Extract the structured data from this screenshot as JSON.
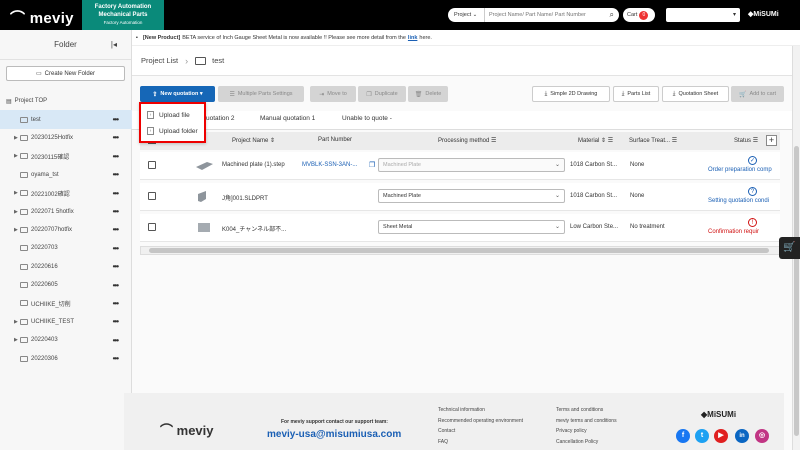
{
  "header": {
    "logo": "meviy",
    "fa_line1": "Factory Automation",
    "fa_line2": "Mechanical Parts",
    "fa_line3": "Factory Automation",
    "search_select": "Project",
    "search_placeholder": "Project Name/ Part Name/ Part Number",
    "cart_label": "Cart",
    "cart_count": "0",
    "brand": "MiSUMi"
  },
  "sidebar": {
    "title": "Folder",
    "create_label": "Create New Folder",
    "root": "Project TOP",
    "items": [
      {
        "label": "test",
        "arrow": "",
        "selected": true
      },
      {
        "label": "20230125Hotfix",
        "arrow": "▶"
      },
      {
        "label": "20230115確認",
        "arrow": "▶"
      },
      {
        "label": "oyama_tst",
        "arrow": ""
      },
      {
        "label": "20221002確認",
        "arrow": "▶"
      },
      {
        "label": "2022071 5hotfix",
        "arrow": "▶"
      },
      {
        "label": "20220707hotfix",
        "arrow": "▶"
      },
      {
        "label": "20220703",
        "arrow": ""
      },
      {
        "label": "20220616",
        "arrow": ""
      },
      {
        "label": "20220605",
        "arrow": ""
      },
      {
        "label": "UCHIIKE_切削",
        "arrow": ""
      },
      {
        "label": "UCHIIKE_TEST",
        "arrow": "▶"
      },
      {
        "label": "20220403",
        "arrow": "▶"
      },
      {
        "label": "20220306",
        "arrow": ""
      }
    ]
  },
  "banner": {
    "tag": "[New Product]",
    "text": "BETA service of Inch Gauge Sheet Metal is now available !! Please see more detail from the",
    "link": "link",
    "tail": "here."
  },
  "breadcrumb": {
    "root": "Project List",
    "current": "test"
  },
  "toolbar": {
    "new_quotation": "New quotation",
    "multiple_parts": "Multiple Parts Settings",
    "move_to": "Move to",
    "duplicate": "Duplicate",
    "delete": "Delete",
    "simple_2d": "Simple 2D Drawing",
    "parts_list": "Parts List",
    "quotation_sheet": "Quotation Sheet",
    "add_to_cart": "Add to cart"
  },
  "popup": {
    "upload_file": "Upload file",
    "upload_folder": "Upload folder"
  },
  "tabs": [
    "uotation 2",
    "Manual quotation 1",
    "Unable to quote -"
  ],
  "table": {
    "headers": {
      "project_name": "Project Name",
      "part_number": "Part Number",
      "processing": "Processing method",
      "material": "Material",
      "surface": "Surface Treat...",
      "status": "Status"
    },
    "rows": [
      {
        "name": "Machined plate (1).step",
        "part": "MVBLK-SSN-3AN-...",
        "process": "Machined Plate",
        "material": "1018 Carbon St...",
        "surface": "None",
        "status": "Order preparation comp",
        "status_color": "#1a5fb4",
        "status_icon": "✓"
      },
      {
        "name": "J角]001.SLDPRT",
        "part": "",
        "process": "Machined Plate",
        "material": "1018 Carbon St...",
        "surface": "None",
        "status": "Setting quotation condi",
        "status_color": "#1a5fb4",
        "status_icon": "?"
      },
      {
        "name": "K004_チャンネル部不...",
        "part": "",
        "process": "Sheet Metal",
        "material": "Low Carbon Ste...",
        "surface": "No treatment",
        "status": "Confirmation requir",
        "status_color": "#d01010",
        "status_icon": "!"
      }
    ]
  },
  "footer": {
    "logo": "meviy",
    "support": "For meviy support contact our support team:",
    "email": "meviy-usa@misumiusa.com",
    "col1": [
      "Technical information",
      "Recommended operating environment",
      "Contact",
      "FAQ"
    ],
    "col2": [
      "Terms and conditions",
      "meviy terms and conditions",
      "Privacy policy",
      "Cancellation Policy"
    ],
    "brand": "MiSUMi",
    "social": [
      "f",
      "t",
      "▶",
      "in",
      "◎"
    ]
  }
}
